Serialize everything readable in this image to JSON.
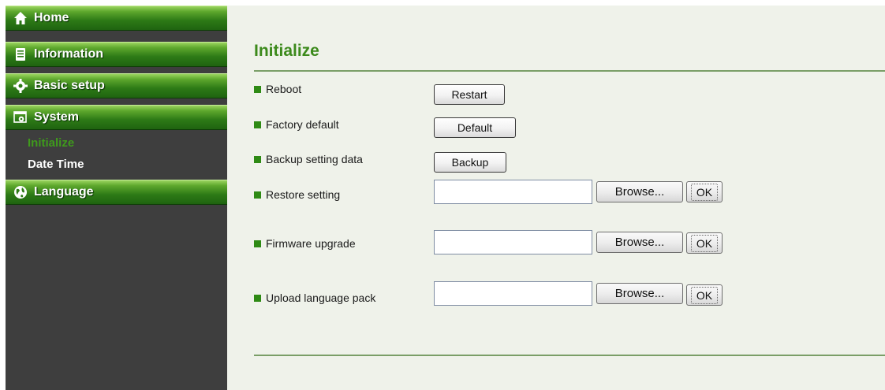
{
  "sidebar": {
    "menu": [
      {
        "label": "Home",
        "icon": "home-icon"
      },
      {
        "label": "Information",
        "icon": "document-icon"
      },
      {
        "label": "Basic setup",
        "icon": "gear-icon"
      },
      {
        "label": "System",
        "icon": "system-icon"
      },
      {
        "label": "Language",
        "icon": "globe-icon"
      }
    ],
    "system_submenu": [
      {
        "label": "Initialize",
        "active": true
      },
      {
        "label": "Date Time",
        "active": false
      }
    ]
  },
  "main": {
    "title": "Initialize",
    "rows": [
      {
        "label": "Reboot",
        "button": "Restart"
      },
      {
        "label": "Factory default",
        "button": "Default"
      },
      {
        "label": "Backup setting data",
        "button": "Backup"
      },
      {
        "label": "Restore setting",
        "file_value": "",
        "browse": "Browse...",
        "ok": "OK"
      },
      {
        "label": "Firmware upgrade",
        "file_value": "",
        "browse": "Browse...",
        "ok": "OK"
      },
      {
        "label": "Upload language pack",
        "file_value": "",
        "browse": "Browse...",
        "ok": "OK"
      }
    ]
  },
  "colors": {
    "accent_green": "#3c8a1c",
    "sidebar_bg": "#3e3e3e",
    "content_bg": "#eff2ea"
  }
}
